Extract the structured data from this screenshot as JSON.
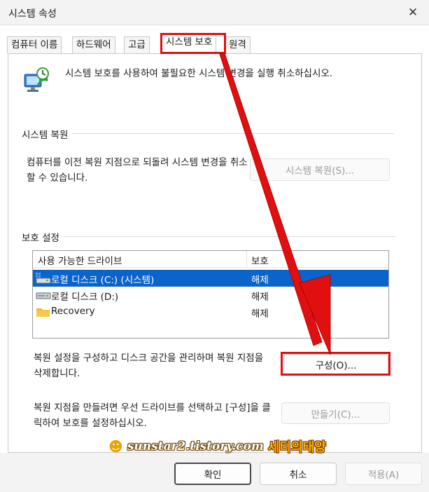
{
  "window": {
    "title": "시스템 속성",
    "close_glyph": "✕"
  },
  "tabs": [
    {
      "label": "컴퓨터 이름",
      "active": false
    },
    {
      "label": "하드웨어",
      "active": false
    },
    {
      "label": "고급",
      "active": false
    },
    {
      "label": "시스템 보호",
      "active": true
    },
    {
      "label": "원격",
      "active": false
    }
  ],
  "intro": {
    "icon": "system-protection-icon",
    "text": "시스템 보호를 사용하여 불필요한 시스템 변경을 실행 취소하십시오."
  },
  "restore": {
    "section_label": "시스템 복원",
    "description": "컴퓨터를 이전 복원 지점으로 되돌려 시스템 변경을 취소할 수 있습니다.",
    "button_label": "시스템 복원(S)...",
    "button_enabled": false
  },
  "protection": {
    "section_label": "보호 설정",
    "columns": [
      "사용 가능한 드라이브",
      "보호"
    ],
    "drives": [
      {
        "name": "로컬 디스크 (C:) (시스템)",
        "protection": "해제",
        "icon": "system-drive-icon",
        "selected": true
      },
      {
        "name": "로컬 디스크 (D:)",
        "protection": "해제",
        "icon": "drive-icon",
        "selected": false
      },
      {
        "name": "Recovery",
        "protection": "해제",
        "icon": "folder-icon",
        "selected": false
      }
    ],
    "configure_description": "복원 설정을 구성하고 디스크 공간을 관리하며 복원 지점을 삭제합니다.",
    "configure_label": "구성(O)...",
    "create_description": "복원 지점을 만들려면 우선 드라이브를 선택하고 [구성]을 클릭하여 보호를 설정하십시오.",
    "create_label": "만들기(C)...",
    "create_enabled": false
  },
  "footer": {
    "ok_label": "확인",
    "cancel_label": "취소",
    "apply_label": "적용(A)",
    "apply_enabled": false
  },
  "watermark": {
    "url": "sunstar2.tistory.com",
    "name": "세티의태양"
  },
  "annotation_color": "#e01010",
  "selection_color": "#0a64c9"
}
